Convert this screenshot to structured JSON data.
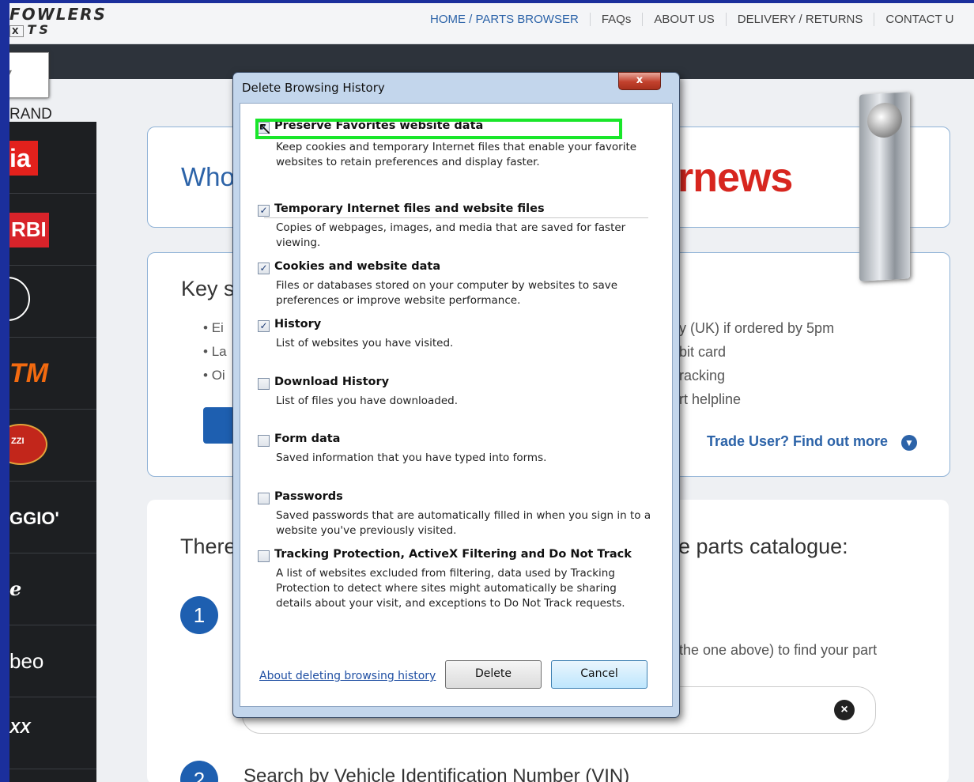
{
  "site": {
    "logo_top": "FOWLERS",
    "logo_bottom": "TS",
    "logo_x": "X",
    "nav": [
      "HOME / PARTS BROWSER",
      "FAQs",
      "ABOUT US",
      "DELIVERY / RETURNS",
      "CONTACT U"
    ],
    "brand_label": "RAND",
    "sidebar_brands": [
      "ia",
      "RBI",
      ")",
      "TM",
      "ZZI",
      "GGIO'",
      "e",
      "beo",
      "XX"
    ],
    "hero_text": "Who",
    "hero_news": "rnews",
    "key_heading": "Key s",
    "bullets": [
      "Ei",
      "La",
      "Oi"
    ],
    "bullets_right": [
      "y (UK) if ordered by 5pm",
      "bit card",
      "racking",
      "rt helpline"
    ],
    "trade_link": "Trade User? Find out more",
    "catalogue_heading_left": "There",
    "catalogue_heading_right": "e parts catalogue:",
    "step1": "1",
    "step2": "2",
    "step1_text": "l the one above) to find your part",
    "vin_text": "Search by Vehicle Identification Number (VIN)"
  },
  "dialog": {
    "title": "Delete Browsing History",
    "close": "x",
    "options": [
      {
        "title": "Preserve Favorites website data",
        "desc": "Keep cookies and temporary Internet files that enable your favorite websites to retain preferences and display faster.",
        "checked": true
      },
      {
        "title": "Temporary Internet files and website files",
        "desc": "Copies of webpages, images, and media that are saved for faster viewing.",
        "checked": true
      },
      {
        "title": "Cookies and website data",
        "desc": "Files or databases stored on your computer by websites to save preferences or improve website performance.",
        "checked": true
      },
      {
        "title": "History",
        "desc": "List of websites you have visited.",
        "checked": true
      },
      {
        "title": "Download History",
        "desc": "List of files you have downloaded.",
        "checked": false
      },
      {
        "title": "Form data",
        "desc": "Saved information that you have typed into forms.",
        "checked": false
      },
      {
        "title": "Passwords",
        "desc": "Saved passwords that are automatically filled in when you sign in to a website you've previously visited.",
        "checked": false
      },
      {
        "title": "Tracking Protection, ActiveX Filtering and Do Not Track",
        "desc": "A list of websites excluded from filtering, data used by Tracking Protection to detect where sites might automatically be sharing details about your visit, and exceptions to Do Not Track requests.",
        "checked": false
      }
    ],
    "about_link": "About deleting browsing history",
    "delete_label": "Delete",
    "cancel_label": "Cancel"
  },
  "colors": {
    "highlight": "#19e62a",
    "accent": "#2c63a8",
    "desktop": "#1b2f9c"
  }
}
